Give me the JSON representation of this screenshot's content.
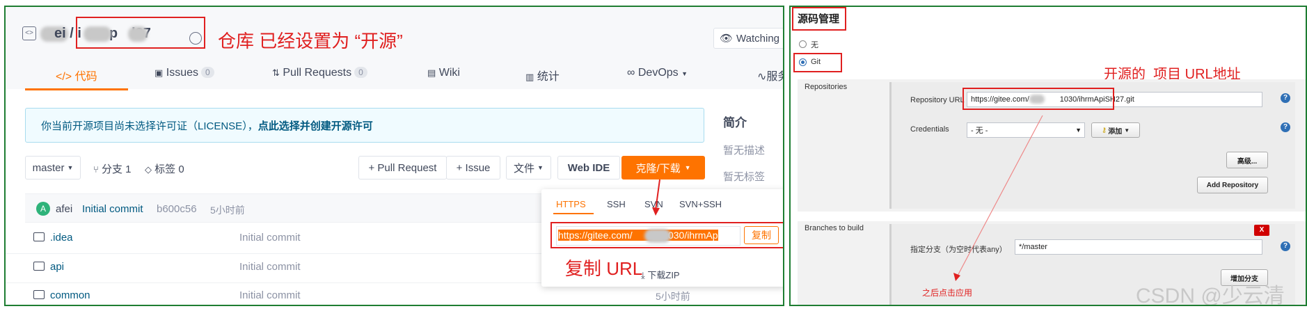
{
  "gitee": {
    "repo_title": "ei / i  p l27",
    "watching_label": "Watching",
    "tabs": [
      {
        "label": "代码",
        "count": null
      },
      {
        "label": "Issues",
        "count": "0"
      },
      {
        "label": "Pull Requests",
        "count": "0"
      },
      {
        "label": "Wiki",
        "count": null
      },
      {
        "label": "统计",
        "count": null
      },
      {
        "label": "DevOps",
        "count": null
      },
      {
        "label": "服务",
        "count": null
      }
    ],
    "license_notice": "你当前开源项目尚未选择许可证（LICENSE），",
    "license_link": "点此选择并创建开源许可",
    "sidebar_title": "简介",
    "no_description": "暂无描述",
    "no_tags": "暂无标签",
    "branch_select": "master",
    "branches_label": "分支 1",
    "tags_label": "标签 0",
    "pull_request_button": "+ Pull Request",
    "issue_button": "+ Issue",
    "file_button": "文件",
    "web_ide_button": "Web IDE",
    "clone_button": "克隆/下载",
    "commit": {
      "avatar_letter": "A",
      "author": "afei",
      "message": "Initial commit",
      "hash": "b600c56",
      "time": "5小时前"
    },
    "files": [
      {
        "name": ".idea",
        "message": "Initial commit"
      },
      {
        "name": "api",
        "message": "Initial commit"
      },
      {
        "name": "common",
        "message": "Initial commit",
        "time": "5小时前"
      }
    ],
    "clone_tabs": [
      "HTTPS",
      "SSH",
      "SVN",
      "SVN+SSH"
    ],
    "clone_url": "https://gitee.com/  341030/ihrmAp",
    "copy_button": "复制",
    "download_zip": "下载ZIP"
  },
  "annotations": {
    "repo_open_source": "仓库 已经设置为 “开源”",
    "copy_url": "复制 URL",
    "open_source_url": "开源的  项目 URL地址",
    "apply_after": "之后点击应用"
  },
  "jenkins": {
    "section_title": "源码管理",
    "scm_none": "无",
    "scm_git": "Git",
    "repositories_label": "Repositories",
    "repository_url_label": "Repository URL",
    "repository_url_value": "https://gitee.com/    1030/ihrmApiSH27.git",
    "credentials_label": "Credentials",
    "credentials_value": "- 无 -",
    "add_button": "添加",
    "advanced_button": "高级...",
    "add_repository_button": "Add Repository",
    "branches_label": "Branches to build",
    "branch_specifier_label": "指定分支（为空时代表any）",
    "branch_specifier_value": "*/master",
    "delete_button": "X",
    "add_branch_button": "增加分支",
    "help_icon_text": "?"
  },
  "watermark": "CSDN @少云清",
  "colors": {
    "gitee_orange": "#fe7300",
    "annotation_red": "#e02020",
    "frame_green": "#1e7d32",
    "link_blue": "#005980"
  }
}
